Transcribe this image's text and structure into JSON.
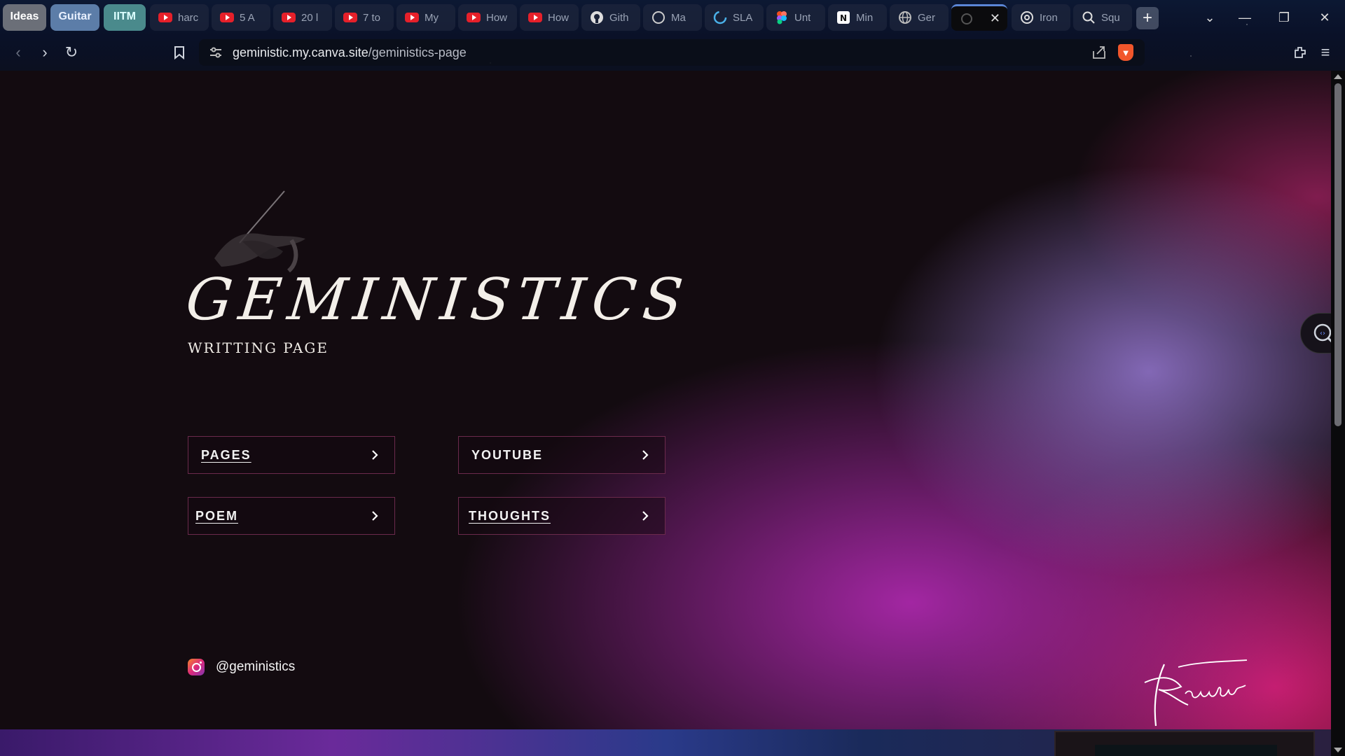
{
  "browser": {
    "tab_groups": [
      "Ideas",
      "Guitar",
      "IITM"
    ],
    "tabs": [
      {
        "label": "harc",
        "icon": "youtube-icon"
      },
      {
        "label": "5 A",
        "icon": "youtube-icon"
      },
      {
        "label": "20 l",
        "icon": "youtube-icon"
      },
      {
        "label": "7 to",
        "icon": "youtube-icon"
      },
      {
        "label": "My",
        "icon": "youtube-icon"
      },
      {
        "label": "How",
        "icon": "youtube-icon"
      },
      {
        "label": "How",
        "icon": "youtube-icon"
      },
      {
        "label": "Gith",
        "icon": "github-icon"
      },
      {
        "label": "Ma",
        "icon": "chatgpt-icon"
      },
      {
        "label": "SLA",
        "icon": "spinner-icon"
      },
      {
        "label": "Unt",
        "icon": "figma-icon"
      },
      {
        "label": "Min",
        "icon": "notion-icon"
      },
      {
        "label": "Ger",
        "icon": "globe-icon"
      },
      {
        "label": "",
        "icon": "loading-icon",
        "active": true
      },
      {
        "label": "Iron",
        "icon": "openai-icon"
      },
      {
        "label": "Squ",
        "icon": "search-icon"
      }
    ],
    "url_host": "geministic.my.canva.site",
    "url_path": "/geministics-page",
    "accent": "#5b86d6"
  },
  "page": {
    "title": "GEMINISTICS",
    "subtitle": "WRITTING PAGE",
    "nav": {
      "pages": "PAGES",
      "youtube": "YOUTUBE",
      "poem": "POEM",
      "thoughts": "THOUGHTS"
    },
    "instagram_handle": "@geministics",
    "signature": "Kaustubh",
    "colors": {
      "background": "#130b10",
      "magenta": "#aa28aa",
      "pink": "#d21e6e",
      "lavender": "#9678d2",
      "card_border": "#6b2a4c"
    }
  }
}
